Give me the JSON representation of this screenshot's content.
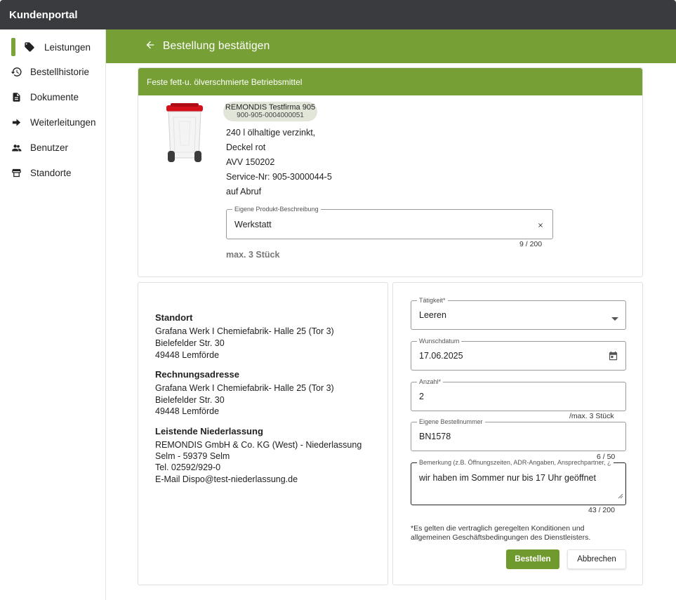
{
  "app": {
    "title": "Kundenportal"
  },
  "sidebar": {
    "items": [
      {
        "label": "Leistungen",
        "icon": "tag-icon",
        "active": true
      },
      {
        "label": "Bestellhistorie",
        "icon": "history-icon"
      },
      {
        "label": "Dokumente",
        "icon": "document-icon"
      },
      {
        "label": "Weiterleitungen",
        "icon": "arrow-right-icon"
      },
      {
        "label": "Benutzer",
        "icon": "users-icon"
      },
      {
        "label": "Standorte",
        "icon": "store-icon"
      }
    ]
  },
  "header": {
    "title": "Bestellung bestätigen"
  },
  "product": {
    "category": "Feste fett-u. ölverschmierte Betriebsmittel",
    "chip": {
      "company": "REMONDIS Testfirma 905",
      "number": "900-905-0004000051"
    },
    "lines": [
      "240 l ölhaltige verzinkt,",
      "Deckel rot",
      "AVV 150202",
      "Service-Nr: 905-3000044-5",
      "auf Abruf"
    ],
    "description": {
      "label": "Eigene Produkt-Beschreibung",
      "value": "Werkstatt",
      "counter": "9 / 200"
    },
    "max_note": "max. 3 Stück"
  },
  "addresses": {
    "standort": {
      "title": "Standort",
      "lines": [
        "Grafana Werk I Chemiefabrik- Halle 25 (Tor 3)",
        "Bielefelder Str. 30",
        "49448 Lemförde"
      ]
    },
    "rechnung": {
      "title": "Rechnungsadresse",
      "lines": [
        "Grafana Werk I Chemiefabrik- Halle 25 (Tor 3)",
        "Bielefelder Str. 30",
        "49448 Lemförde"
      ]
    },
    "niederlassung": {
      "title": "Leistende Niederlassung",
      "lines": [
        "REMONDIS GmbH & Co. KG (West) - Niederlassung",
        "Selm - 59379 Selm",
        "Tel. 02592/929-0",
        "E-Mail Dispo@test-niederlassung.de"
      ]
    }
  },
  "form": {
    "taetigkeit": {
      "label": "Tätigkeit*",
      "value": "Leeren"
    },
    "wunschdatum": {
      "label": "Wunschdatum",
      "value": "17.06.2025"
    },
    "anzahl": {
      "label": "Anzahl*",
      "value": "2",
      "hint": "/max. 3 Stück"
    },
    "bestellnummer": {
      "label": "Eigene Bestellnummer",
      "value": "BN1578",
      "counter": "6 / 50"
    },
    "bemerkung": {
      "label": "Bemerkung (z.B. Öffnungszeiten, ADR-Angaben, Ansprechpartner, ¿",
      "value": "wir haben im Sommer nur bis 17 Uhr geöffnet",
      "counter": "43 / 200"
    },
    "legal": "*Es gelten die vertraglich geregelten Konditionen und allgemeinen Geschäftsbedingungen des Dienstleisters.",
    "submit_label": "Bestellen",
    "cancel_label": "Abbrechen"
  },
  "colors": {
    "accent": "#76a035",
    "topbar": "#3a3b3e",
    "bin_lid": "#d4101a"
  }
}
